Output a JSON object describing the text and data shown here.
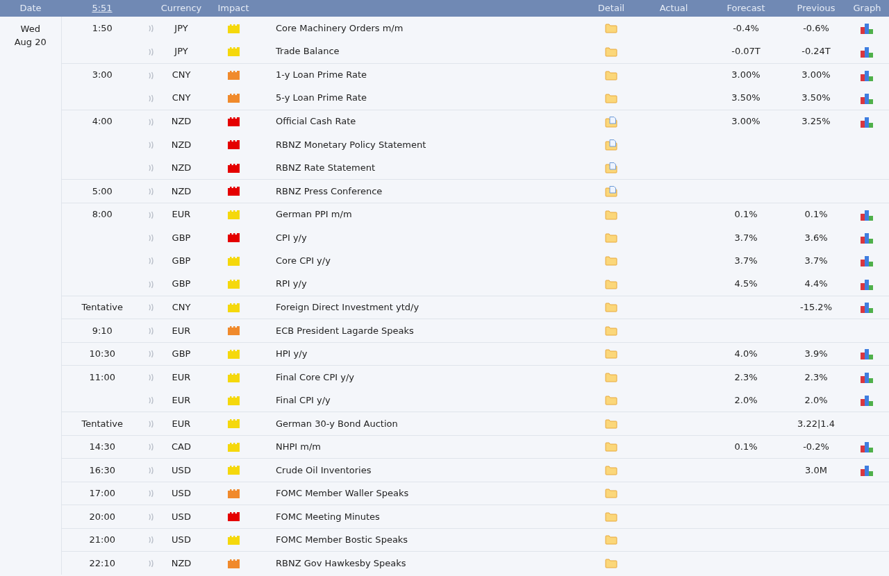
{
  "columns": [
    {
      "label": "Date",
      "kind": "text"
    },
    {
      "label": "5:51",
      "kind": "clock"
    },
    {
      "kind": "blank"
    },
    {
      "label": "Currency",
      "kind": "text"
    },
    {
      "label": "Impact",
      "kind": "text"
    },
    {
      "kind": "blank"
    },
    {
      "label": "Detail",
      "kind": "text"
    },
    {
      "label": "Actual",
      "kind": "text"
    },
    {
      "label": "Forecast",
      "kind": "text"
    },
    {
      "label": "Previous",
      "kind": "text"
    },
    {
      "label": "Graph",
      "kind": "text"
    }
  ],
  "day": {
    "weekday": "Wed",
    "date": "Aug 20"
  },
  "groups": [
    {
      "time": "1:50",
      "events": [
        {
          "currency": "JPY",
          "impact": {
            "color": "#f5d80c"
          },
          "title": "Core Machinery Orders m/m",
          "detail": {
            "kind": "folder"
          },
          "forecast": "-0.4%",
          "previous": "-0.6%",
          "graph": true
        },
        {
          "currency": "JPY",
          "impact": {
            "color": "#f5d80c"
          },
          "title": "Trade Balance",
          "detail": {
            "kind": "folder"
          },
          "forecast": "-0.07T",
          "previous": "-0.24T",
          "graph": true
        }
      ]
    },
    {
      "time": "3:00",
      "events": [
        {
          "currency": "CNY",
          "impact": {
            "color": "#f08a2c"
          },
          "title": "1-y Loan Prime Rate",
          "detail": {
            "kind": "folder"
          },
          "forecast": "3.00%",
          "previous": "3.00%",
          "graph": true
        },
        {
          "currency": "CNY",
          "impact": {
            "color": "#f08a2c"
          },
          "title": "5-y Loan Prime Rate",
          "detail": {
            "kind": "folder"
          },
          "forecast": "3.50%",
          "previous": "3.50%",
          "graph": true
        }
      ]
    },
    {
      "time": "4:00",
      "events": [
        {
          "currency": "NZD",
          "impact": {
            "color": "#e40000"
          },
          "title": "Official Cash Rate",
          "detail": {
            "kind": "document"
          },
          "forecast": "3.00%",
          "previous": "3.25%",
          "graph": true
        },
        {
          "currency": "NZD",
          "impact": {
            "color": "#e40000"
          },
          "title": "RBNZ Monetary Policy Statement",
          "detail": {
            "kind": "document"
          },
          "graph": false
        },
        {
          "currency": "NZD",
          "impact": {
            "color": "#e40000"
          },
          "title": "RBNZ Rate Statement",
          "detail": {
            "kind": "document"
          },
          "graph": false
        }
      ]
    },
    {
      "time": "5:00",
      "events": [
        {
          "currency": "NZD",
          "impact": {
            "color": "#e40000"
          },
          "title": "RBNZ Press Conference",
          "detail": {
            "kind": "document"
          },
          "graph": false
        }
      ]
    },
    {
      "time": "8:00",
      "events": [
        {
          "currency": "EUR",
          "impact": {
            "color": "#f5d80c"
          },
          "title": "German PPI m/m",
          "detail": {
            "kind": "folder"
          },
          "forecast": "0.1%",
          "previous": "0.1%",
          "graph": true
        },
        {
          "currency": "GBP",
          "impact": {
            "color": "#e40000"
          },
          "title": "CPI y/y",
          "detail": {
            "kind": "folder"
          },
          "forecast": "3.7%",
          "previous": "3.6%",
          "graph": true
        },
        {
          "currency": "GBP",
          "impact": {
            "color": "#f5d80c"
          },
          "title": "Core CPI y/y",
          "detail": {
            "kind": "folder"
          },
          "forecast": "3.7%",
          "previous": "3.7%",
          "graph": true
        },
        {
          "currency": "GBP",
          "impact": {
            "color": "#f5d80c"
          },
          "title": "RPI y/y",
          "detail": {
            "kind": "folder"
          },
          "forecast": "4.5%",
          "previous": "4.4%",
          "graph": true
        }
      ]
    },
    {
      "time": "Tentative",
      "events": [
        {
          "currency": "CNY",
          "impact": {
            "color": "#f5d80c"
          },
          "title": "Foreign Direct Investment ytd/y",
          "detail": {
            "kind": "folder"
          },
          "previous": "-15.2%",
          "graph": true
        }
      ]
    },
    {
      "time": "9:10",
      "events": [
        {
          "currency": "EUR",
          "impact": {
            "color": "#f08a2c"
          },
          "title": "ECB President Lagarde Speaks",
          "detail": {
            "kind": "folder"
          },
          "graph": false
        }
      ]
    },
    {
      "time": "10:30",
      "events": [
        {
          "currency": "GBP",
          "impact": {
            "color": "#f5d80c"
          },
          "title": "HPI y/y",
          "detail": {
            "kind": "folder"
          },
          "forecast": "4.0%",
          "previous": "3.9%",
          "graph": true
        }
      ]
    },
    {
      "time": "11:00",
      "events": [
        {
          "currency": "EUR",
          "impact": {
            "color": "#f5d80c"
          },
          "title": "Final Core CPI y/y",
          "detail": {
            "kind": "folder"
          },
          "forecast": "2.3%",
          "previous": "2.3%",
          "graph": true
        },
        {
          "currency": "EUR",
          "impact": {
            "color": "#f5d80c"
          },
          "title": "Final CPI y/y",
          "detail": {
            "kind": "folder"
          },
          "forecast": "2.0%",
          "previous": "2.0%",
          "graph": true
        }
      ]
    },
    {
      "time": "Tentative",
      "events": [
        {
          "currency": "EUR",
          "impact": {
            "color": "#f5d80c"
          },
          "title": "German 30-y Bond Auction",
          "detail": {
            "kind": "folder"
          },
          "previous": "3.22|1.4",
          "graph": false
        }
      ]
    },
    {
      "time": "14:30",
      "events": [
        {
          "currency": "CAD",
          "impact": {
            "color": "#f5d80c"
          },
          "title": "NHPI m/m",
          "detail": {
            "kind": "folder"
          },
          "forecast": "0.1%",
          "previous": "-0.2%",
          "graph": true
        }
      ]
    },
    {
      "time": "16:30",
      "events": [
        {
          "currency": "USD",
          "impact": {
            "color": "#f5d80c"
          },
          "title": "Crude Oil Inventories",
          "detail": {
            "kind": "folder"
          },
          "previous": "3.0M",
          "graph": true
        }
      ]
    },
    {
      "time": "17:00",
      "events": [
        {
          "currency": "USD",
          "impact": {
            "color": "#f08a2c"
          },
          "title": "FOMC Member Waller Speaks",
          "detail": {
            "kind": "folder"
          },
          "graph": false
        }
      ]
    },
    {
      "time": "20:00",
      "events": [
        {
          "currency": "USD",
          "impact": {
            "color": "#e40000"
          },
          "title": "FOMC Meeting Minutes",
          "detail": {
            "kind": "folder"
          },
          "graph": false
        }
      ]
    },
    {
      "time": "21:00",
      "events": [
        {
          "currency": "USD",
          "impact": {
            "color": "#f5d80c"
          },
          "title": "FOMC Member Bostic Speaks",
          "detail": {
            "kind": "folder"
          },
          "graph": false
        }
      ]
    },
    {
      "time": "22:10",
      "events": [
        {
          "currency": "NZD",
          "impact": {
            "color": "#f08a2c"
          },
          "title": "RBNZ Gov Hawkesby Speaks",
          "detail": {
            "kind": "folder"
          },
          "graph": false
        }
      ]
    }
  ]
}
